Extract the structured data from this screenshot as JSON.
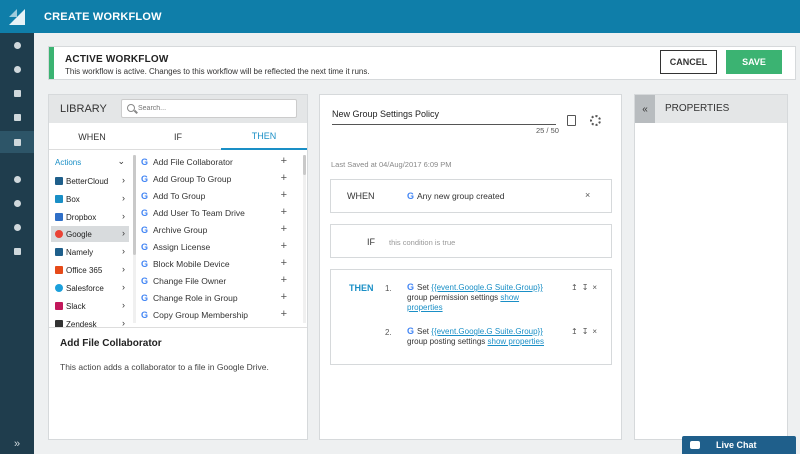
{
  "header": {
    "title": "CREATE WORKFLOW"
  },
  "nav_rail": {
    "icons": [
      "logo-icon",
      "lightbulb-icon",
      "bell-icon",
      "users-icon",
      "layers-icon",
      "workflow-icon",
      "refresh-icon",
      "user-settings-icon",
      "integrations-icon",
      "chat-icon"
    ],
    "expand": "»"
  },
  "banner": {
    "title": "ACTIVE WORKFLOW",
    "description": "This workflow is active. Changes to this workflow will be reflected the next time it runs.",
    "accent_color": "#3bb372"
  },
  "actions": {
    "cancel": "CANCEL",
    "save": "SAVE"
  },
  "library": {
    "title": "LIBRARY",
    "search_placeholder": "Search...",
    "tabs": [
      "WHEN",
      "IF",
      "THEN"
    ],
    "active_tab": "THEN",
    "categories_header": "Actions",
    "categories": [
      "BetterCloud",
      "Box",
      "Dropbox",
      "Google",
      "Namely",
      "Office 365",
      "Salesforce",
      "Slack",
      "Zendesk"
    ],
    "selected_category": "Google",
    "action_items": [
      "Add File Collaborator",
      "Add Group To Group",
      "Add To Group",
      "Add User To Team Drive",
      "Archive Group",
      "Assign License",
      "Block Mobile Device",
      "Change File Owner",
      "Change Role in Group",
      "Copy Group Membership"
    ],
    "detail_title": "Add File Collaborator",
    "detail_description": "This action adds a collaborator to a file in Google Drive."
  },
  "workflow": {
    "name": "New Group Settings Policy",
    "char_count": "25 / 50",
    "last_saved": "Last Saved at 04/Aug/2017 6:09 PM",
    "when_label": "WHEN",
    "when_trigger": "Any new group created",
    "if_label": "IF",
    "if_condition": "this condition is true",
    "then_label": "THEN",
    "steps": [
      {
        "num": "1.",
        "prefix": "Set",
        "link": "{{event.Google.G Suite.Group}}",
        "suffix": "group permission settings",
        "show": "show properties"
      },
      {
        "num": "2.",
        "prefix": "Set",
        "link": "{{event.Google.G Suite.Group}}",
        "suffix": "group posting settings",
        "show": "show properties"
      }
    ]
  },
  "properties": {
    "title": "PROPERTIES",
    "collapse": "«"
  },
  "live_chat": {
    "label": "Live Chat"
  },
  "colors": {
    "brand": "#0f7ea9",
    "nav": "#1f3d4d",
    "link": "#1a8fc6",
    "save": "#3bb372"
  }
}
